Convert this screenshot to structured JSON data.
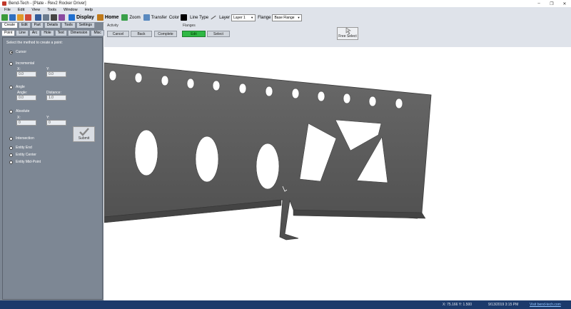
{
  "window": {
    "title": "Bend-Tech - [Plate - Rev2 Rocker Driver]"
  },
  "menu": [
    "File",
    "Edit",
    "View",
    "Tools",
    "Window",
    "Help"
  ],
  "toolbar": {
    "display_label": "Display",
    "home_label": "Home",
    "zoom_label": "Zoom",
    "transfer_label": "Transfer",
    "color_label": "Color",
    "line_type_label": "Line Type",
    "layer_label": "Layer",
    "layer_value": "Layer 1",
    "flange_label": "Flange",
    "flange_value": "Base Flange"
  },
  "tabs_primary": [
    "Create",
    "Edit",
    "Part",
    "Details",
    "Tools",
    "Settings"
  ],
  "tabs_secondary": [
    "Point",
    "Line",
    "Arc",
    "Hole",
    "Text",
    "Dimension",
    "Misc"
  ],
  "panel": {
    "instruction": "Select the method to create a point:",
    "cursor": "Cursor",
    "incremental": "Incremental",
    "inc_x_label": "X:",
    "inc_y_label": "Y:",
    "inc_x": "0.0",
    "inc_y": "0.0",
    "angle": "Angle",
    "angle_label": "Angle:",
    "distance_label": "Distance:",
    "angle_value": "0.0",
    "distance_value": "1.0",
    "absolute": "Absolute",
    "abs_x_label": "X:",
    "abs_y_label": "Y:",
    "abs_x": "0",
    "abs_y": "0",
    "submit": "Submit",
    "intersection": "Intersection",
    "entity_end": "Entity End",
    "entity_center": "Entity Center",
    "entity_mid": "Entity Mid-Point"
  },
  "ribbon": {
    "activity_title": "Activity",
    "cancel": "Cancel",
    "back": "Back",
    "complete": "Complete",
    "flanges_title": "Flanges",
    "flange_btn": "Edit",
    "select": "Select",
    "free_select": "Free Select"
  },
  "status": {
    "coords": "X: 75.166  Y: 1.500",
    "datetime": "9/13/2019   3:15 PM",
    "link": "Visit bend-tech.com"
  },
  "colors": {
    "panel": "#7d8794",
    "part": "#5a5a5a",
    "status": "#1c3a6b",
    "accent": "#2fb844"
  }
}
